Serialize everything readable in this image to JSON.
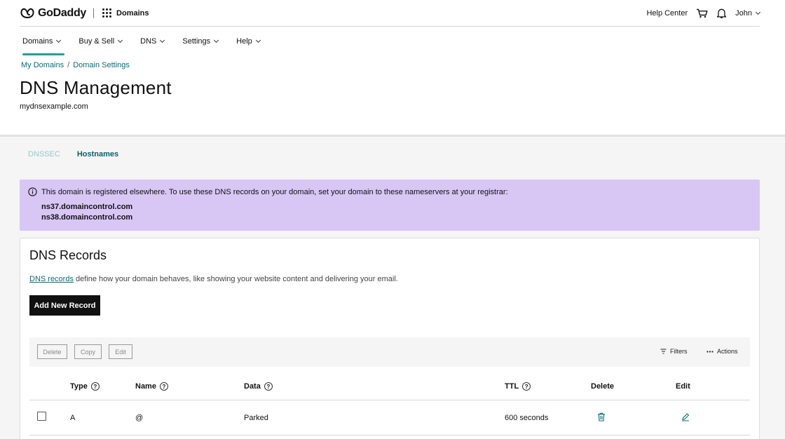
{
  "header": {
    "brand": "GoDaddy",
    "app_name": "Domains",
    "help_center": "Help Center",
    "user_name": "John"
  },
  "nav": {
    "items": [
      {
        "label": "Domains"
      },
      {
        "label": "Buy & Sell"
      },
      {
        "label": "DNS"
      },
      {
        "label": "Settings"
      },
      {
        "label": "Help"
      }
    ]
  },
  "breadcrumb": {
    "items": [
      {
        "label": "My Domains"
      },
      {
        "label": "Domain Settings"
      }
    ],
    "separator": "/"
  },
  "page": {
    "title": "DNS Management",
    "domain": "mydnsexample.com"
  },
  "tabs": [
    {
      "label": "DNSSEC"
    },
    {
      "label": "Hostnames"
    }
  ],
  "notice": {
    "message": "This domain is registered elsewhere. To use these DNS records on your domain, set your domain to these nameservers at your registrar:",
    "nameservers": [
      "ns37.domaincontrol.com",
      "ns38.domaincontrol.com"
    ]
  },
  "records": {
    "title": "DNS Records",
    "desc_link": "DNS records",
    "desc_rest": " define how your domain behaves, like showing your website content and delivering your email.",
    "add_button": "Add New Record",
    "toolbar": {
      "delete": "Delete",
      "copy": "Copy",
      "edit": "Edit",
      "filters": "Filters",
      "actions": "Actions"
    },
    "columns": {
      "type": "Type",
      "name": "Name",
      "data": "Data",
      "ttl": "TTL",
      "delete": "Delete",
      "edit": "Edit"
    },
    "rows": [
      {
        "type": "A",
        "name": "@",
        "data": "Parked",
        "ttl": "600 seconds"
      }
    ]
  },
  "colors": {
    "accent": "#1ca1a1",
    "link": "#0a6b78",
    "notice_bg": "#d8c6f5",
    "icon_delete": "#0a6b78",
    "icon_edit": "#0a6b78"
  }
}
